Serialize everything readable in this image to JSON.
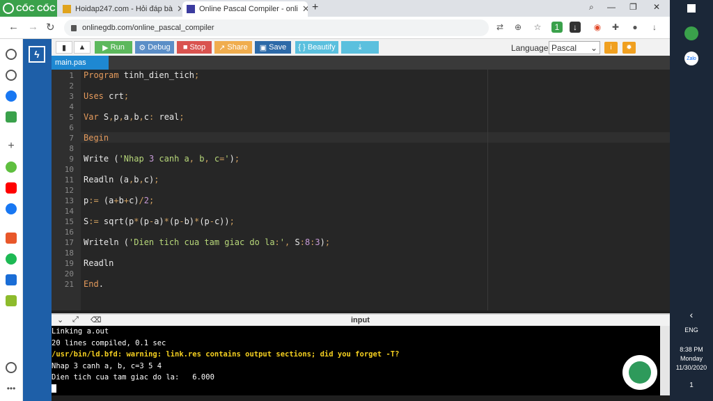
{
  "browser": {
    "brand": "CỐC CỐC",
    "tabs": [
      {
        "label": "Hoidap247.com - Hỏi đáp bà"
      },
      {
        "label": "Online Pascal Compiler - onli"
      }
    ],
    "new_tab": "+",
    "url": "onlinegdb.com/online_pascal_compiler"
  },
  "toolbar": {
    "run": "Run",
    "debug": "Debug",
    "stop": "Stop",
    "share": "Share",
    "save": "Save",
    "beautify": "{ } Beautify",
    "language_label": "Language",
    "language_value": "Pascal",
    "colors": {
      "run": "#5cb85c",
      "debug": "#5b8ec7",
      "stop": "#d9534f",
      "share": "#f0ad4e",
      "save": "#2d6aa8",
      "beautify": "#5bc0de",
      "download": "#5bc0de"
    }
  },
  "file_tab": "main.pas",
  "editor": {
    "line_numbers": [
      "1",
      "2",
      "3",
      "4",
      "5",
      "6",
      "7",
      "8",
      "9",
      "10",
      "11",
      "12",
      "13",
      "14",
      "15",
      "16",
      "17",
      "18",
      "19",
      "20",
      "21"
    ],
    "lines": [
      {
        "n": 1,
        "text": "Program tinh_dien_tich;"
      },
      {
        "n": 3,
        "text": "Uses crt;"
      },
      {
        "n": 5,
        "text": "Var S,p,a,b,c: real;"
      },
      {
        "n": 7,
        "text": "Begin"
      },
      {
        "n": 9,
        "text": "Write ('Nhap 3 canh a, b, c=');"
      },
      {
        "n": 11,
        "text": "Readln (a,b,c);"
      },
      {
        "n": 13,
        "text": "p:= (a+b+c)/2;"
      },
      {
        "n": 15,
        "text": "S:= sqrt(p*(p-a)*(p-b)*(p-c));"
      },
      {
        "n": 17,
        "text": "Writeln ('Dien tich cua tam giac do la:', S:8:3);"
      },
      {
        "n": 19,
        "text": "Readln"
      },
      {
        "n": 21,
        "text": "End."
      }
    ]
  },
  "output": {
    "title": "input",
    "lines": [
      "Linking a.out",
      "20 lines compiled, 0.1 sec",
      "/usr/bin/ld.bfd: warning: link.res contains output sections; did you forget -T?",
      "Nhap 3 canh a, b, c=3 5 4",
      "Dien tich cua tam giac do la:   6.000"
    ]
  },
  "taskbar": {
    "lang": "ENG",
    "time": "8:38 PM",
    "day": "Monday",
    "date": "11/30/2020",
    "zalo": "Zalo",
    "notif_count": "1"
  }
}
